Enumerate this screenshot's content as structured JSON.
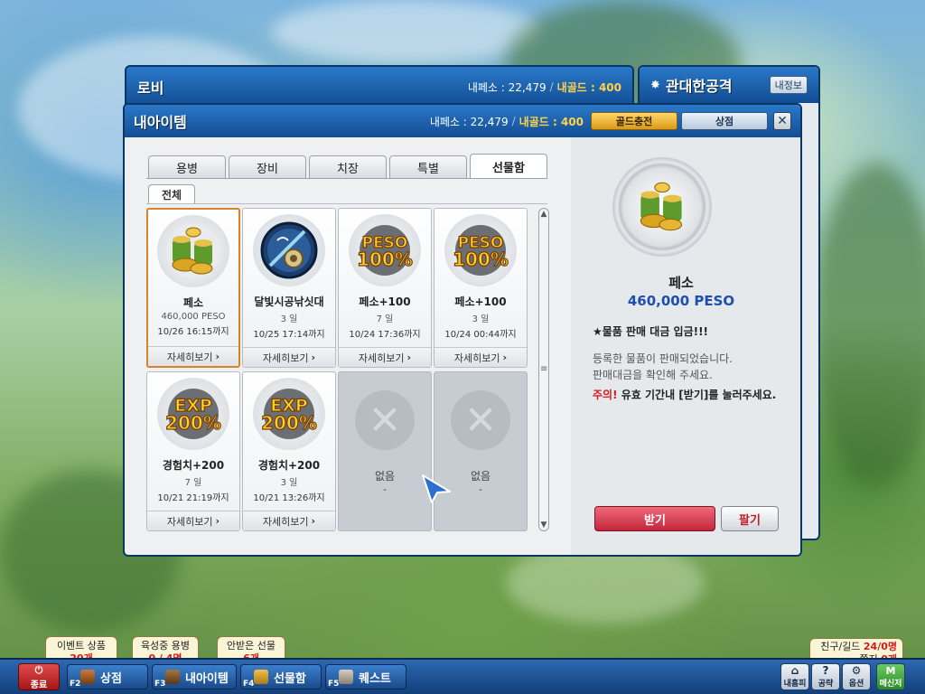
{
  "lobby": {
    "title": "로비",
    "peso_label": "내페소 : 22,479",
    "sep": "/",
    "gold_label": "내골드 : 400"
  },
  "attack_window": {
    "title": "관대한공격",
    "info_button": "내정보"
  },
  "main": {
    "title": "내아이템",
    "peso_label": "내페소 : 22,479",
    "sep": "/",
    "gold_label": "내골드 : 400",
    "charge_button": "골드충전",
    "shop_button": "상점",
    "close_glyph": "✕",
    "tabs": [
      {
        "label": "용병"
      },
      {
        "label": "장비"
      },
      {
        "label": "치장"
      },
      {
        "label": "특별"
      },
      {
        "label": "선물함"
      }
    ],
    "subtab": "전체",
    "items": [
      {
        "name": "페소",
        "sub": "460,000 PESO",
        "until": "10/26 16:15까지",
        "more": "자세히보기",
        "icon": "peso-coins-icon"
      },
      {
        "name": "달빛시공낚싯대",
        "sub": "3 일",
        "until": "10/25 17:14까지",
        "more": "자세히보기",
        "icon": "fishing-rod-icon"
      },
      {
        "name": "페소+100",
        "sub": "7 일",
        "until": "10/24 17:36까지",
        "more": "자세히보기",
        "icon": "peso-100-icon",
        "badge_top": "PESO",
        "badge_bottom": "100%"
      },
      {
        "name": "페소+100",
        "sub": "3 일",
        "until": "10/24 00:44까지",
        "more": "자세히보기",
        "icon": "peso-100-icon",
        "badge_top": "PESO",
        "badge_bottom": "100%"
      },
      {
        "name": "경험치+200",
        "sub": "7 일",
        "until": "10/21 21:19까지",
        "more": "자세히보기",
        "icon": "exp-200-icon",
        "badge_top": "EXP",
        "badge_bottom": "200%"
      },
      {
        "name": "경험치+200",
        "sub": "3 일",
        "until": "10/21 13:26까지",
        "more": "자세히보기",
        "icon": "exp-200-icon",
        "badge_top": "EXP",
        "badge_bottom": "200%"
      },
      {
        "name": "없음",
        "sub": "-",
        "icon": "x-icon"
      },
      {
        "name": "없음",
        "sub": "-",
        "icon": "x-icon"
      }
    ],
    "more_arrow": "›"
  },
  "detail": {
    "name": "페소",
    "amount": "460,000 PESO",
    "notice": "★물품 판매 대금 입금!!!",
    "line1": "등록한 물품이 판매되었습니다.",
    "line2": "판매대금을 확인해 주세요.",
    "warn_prefix": "주의!",
    "warn_text": " 유효 기간내 [받기]를 눌러주세요.",
    "receive_button": "받기",
    "sell_button": "팔기"
  },
  "bottom": {
    "quit_label": "종료",
    "buttons": [
      {
        "key": "F2",
        "label": "상점"
      },
      {
        "key": "F3",
        "label": "내아이템"
      },
      {
        "key": "F4",
        "label": "선물함"
      },
      {
        "key": "F5",
        "label": "퀘스트"
      }
    ],
    "bubbles": [
      {
        "title": "이벤트 상품",
        "value": "20개"
      },
      {
        "title": "육성중 용병",
        "value": "0 / 4명"
      },
      {
        "title": "안받은 선물",
        "value": "6개"
      }
    ],
    "friends_label": "친구/길드",
    "friends_value": "24/0명",
    "notes_label": "쪽지",
    "notes_value": "0개",
    "small_buttons": [
      {
        "label": "내홈피"
      },
      {
        "label": "공략"
      },
      {
        "label": "옵션"
      },
      {
        "label": "메신저"
      }
    ]
  },
  "colors": {
    "title_bar": "#124d93",
    "gold_text": "#ffd24a",
    "accent_red": "#d21d1d",
    "amount_blue": "#1d4fae",
    "selected_border": "#d8822a"
  }
}
